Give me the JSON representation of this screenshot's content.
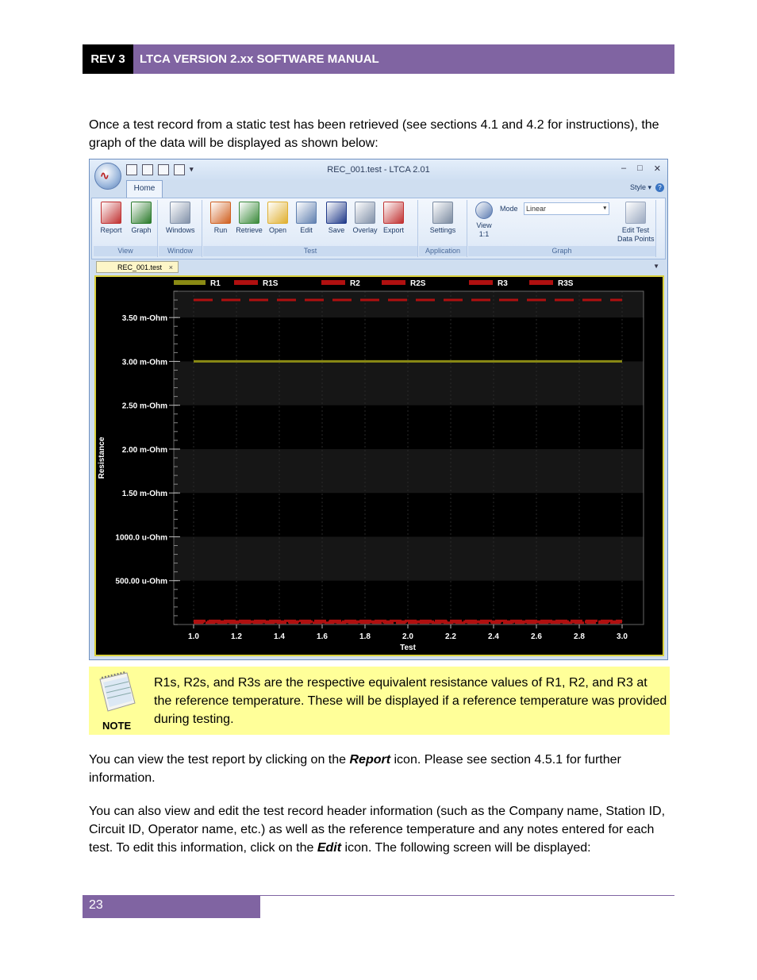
{
  "header": {
    "rev": "REV 3",
    "title": "LTCA VERSION 2.xx SOFTWARE MANUAL"
  },
  "intro": "Once a test record from a static test has been retrieved (see sections 4.1 and 4.2 for instructions), the graph of the data will be displayed as shown below:",
  "app": {
    "window_title": "REC_001.test - LTCA 2.01",
    "orb_glyph": "∿",
    "qat_more": "▾",
    "controls": {
      "minimize": "–",
      "maximize": "□",
      "close": "✕"
    },
    "tab_home": "Home",
    "style_label": "Style ▾",
    "help": "?",
    "groups": [
      {
        "label": "View",
        "buttons": [
          {
            "label": "Report",
            "icon": "report-icon",
            "color": "#c03030"
          },
          {
            "label": "Graph",
            "icon": "graph-icon",
            "color": "#2a7a2a"
          }
        ]
      },
      {
        "label": "Window",
        "buttons": [
          {
            "label": "Windows",
            "icon": "windows-icon",
            "color": "#8090a8"
          }
        ]
      },
      {
        "label": "Test",
        "buttons": [
          {
            "label": "Run",
            "icon": "run-icon",
            "color": "#d06020"
          },
          {
            "label": "Retrieve",
            "icon": "retrieve-icon",
            "color": "#3a8a3a"
          },
          {
            "label": "Open",
            "icon": "open-icon",
            "color": "#e0b030"
          },
          {
            "label": "Edit",
            "icon": "edit-icon",
            "color": "#6080b0"
          },
          {
            "label": "Save",
            "icon": "save-icon",
            "color": "#203a8a"
          },
          {
            "label": "Overlay",
            "icon": "overlay-icon",
            "color": "#8090a8"
          },
          {
            "label": "Export",
            "icon": "export-icon",
            "color": "#c03030"
          }
        ]
      },
      {
        "label": "Application",
        "buttons": [
          {
            "label": "Settings",
            "icon": "settings-icon",
            "color": "#7a8aa0"
          }
        ]
      },
      {
        "label": "Graph",
        "buttons": [
          {
            "label": "View\n1:1",
            "icon": "zoom-icon",
            "color": "#5a7ab0"
          },
          {
            "label": "Edit Test\nData Points",
            "icon": "edit-points-icon",
            "color": "#9aa8c0"
          }
        ]
      }
    ],
    "mode_label": "Mode",
    "mode_value": "Linear",
    "mode_arrow": "▾",
    "doc_tab": "REC_001.test",
    "doc_tab_close": "×",
    "doc_arrow": "▼"
  },
  "chart_data": {
    "type": "line",
    "xlabel": "Test",
    "ylabel": "Resistance",
    "xlim": [
      1.0,
      3.0
    ],
    "ylim": [
      0.0,
      3.8
    ],
    "x_ticks": [
      "1.0",
      "1.2",
      "1.4",
      "1.6",
      "1.8",
      "2.0",
      "2.2",
      "2.4",
      "2.6",
      "2.8",
      "3.0"
    ],
    "y_ticks": [
      {
        "value": 3.5,
        "label": "3.50 m-Ohm"
      },
      {
        "value": 3.0,
        "label": "3.00 m-Ohm"
      },
      {
        "value": 2.5,
        "label": "2.50 m-Ohm"
      },
      {
        "value": 2.0,
        "label": "2.00 m-Ohm"
      },
      {
        "value": 1.5,
        "label": "1.50 m-Ohm"
      },
      {
        "value": 1.0,
        "label": "1000.0 u-Ohm"
      },
      {
        "value": 0.5,
        "label": "500.00 u-Ohm"
      }
    ],
    "legend_position": "top",
    "series": [
      {
        "name": "R1",
        "color": "#8a8a14",
        "style": "solid",
        "x": [
          1.0,
          3.0
        ],
        "values": [
          3.0,
          3.0
        ]
      },
      {
        "name": "R1S",
        "color": "#b01010",
        "style": "dashed",
        "x": [
          1.0,
          3.0
        ],
        "values": [
          3.7,
          3.7
        ]
      },
      {
        "name": "R2",
        "color": "#b01010",
        "style": "dashed",
        "x": [
          1.0,
          3.0
        ],
        "values": [
          0.02,
          0.02
        ]
      },
      {
        "name": "R2S",
        "color": "#b01010",
        "style": "dashed",
        "x": [
          1.0,
          3.0
        ],
        "values": [
          0.02,
          0.02
        ]
      },
      {
        "name": "R3",
        "color": "#b01010",
        "style": "dashed",
        "x": [
          1.0,
          3.0
        ],
        "values": [
          0.02,
          0.02
        ]
      },
      {
        "name": "R3S",
        "color": "#b01010",
        "style": "dashed",
        "x": [
          1.0,
          3.0
        ],
        "values": [
          0.02,
          0.02
        ]
      }
    ],
    "grid": true
  },
  "note": {
    "label": "NOTE",
    "text": "R1s, R2s, and R3s are the respective equivalent resistance values of R1, R2, and R3 at the reference temperature. These will be displayed if a reference temperature was provided during testing."
  },
  "para2": {
    "before": "You can view the test report by clicking on the ",
    "bold": "Report",
    "after": " icon. Please see section 4.5.1 for further information."
  },
  "para3": {
    "before": "You can also view and edit the test record header information (such as the Company name, Station ID, Circuit ID, Operator name, etc.) as well as the reference temperature and any notes entered for each test. To edit this information, click on the ",
    "bold": "Edit",
    "after": " icon. The following screen will be displayed:"
  },
  "page_number": "23"
}
